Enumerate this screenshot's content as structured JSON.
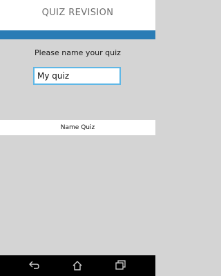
{
  "app": {
    "title": "QUIZ REVISION"
  },
  "form": {
    "prompt": "Please name your quiz",
    "input_value": "My quiz"
  },
  "actions": {
    "name_quiz_label": "Name Quiz"
  },
  "colors": {
    "accent": "#2a7cb5",
    "input_border": "#5fb7e6",
    "background": "#d4d4d4"
  },
  "nav": {
    "icons": [
      "back-icon",
      "home-icon",
      "recent-apps-icon"
    ]
  }
}
